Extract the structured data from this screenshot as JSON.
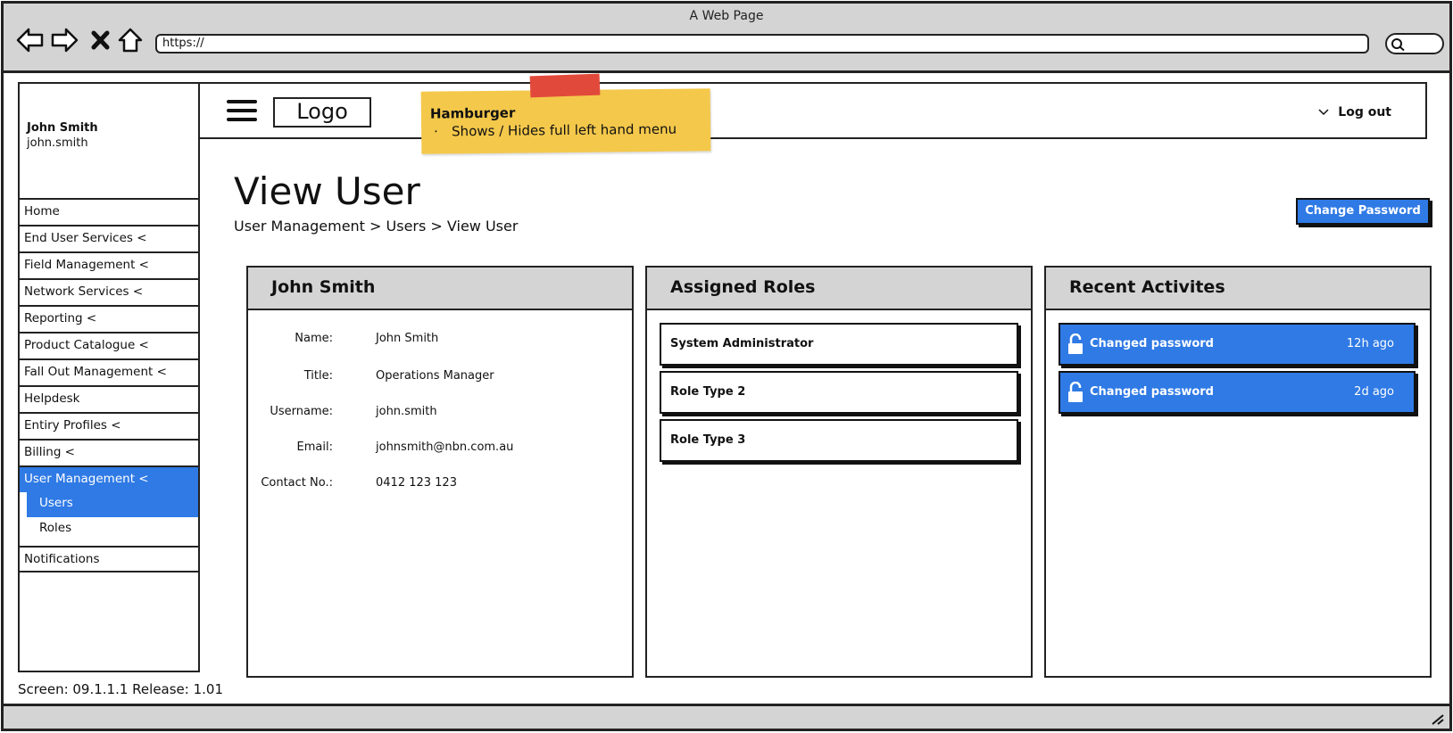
{
  "browser": {
    "window_title": "A Web Page",
    "url": "https://",
    "nav_icons": [
      "back-arrow-icon",
      "forward-arrow-icon",
      "close-x-icon",
      "home-icon"
    ],
    "search_icon": "search-icon"
  },
  "sidebar": {
    "user_name": "John Smith",
    "user_login": "john.smith",
    "items": [
      {
        "label": "Home"
      },
      {
        "label": "End User Services <"
      },
      {
        "label": "Field Management <"
      },
      {
        "label": "Network Services <"
      },
      {
        "label": "Reporting <"
      },
      {
        "label": "Product Catalogue <"
      },
      {
        "label": "Fall Out Management <"
      },
      {
        "label": "Helpdesk"
      },
      {
        "label": "Entiry Profiles <"
      },
      {
        "label": "Billing <"
      },
      {
        "label": "User Management <",
        "active": true
      }
    ],
    "submenu": [
      {
        "label": "Users",
        "active": true
      },
      {
        "label": "Roles"
      }
    ],
    "notifications": "Notifications"
  },
  "header": {
    "logo": "Logo",
    "logout": "Log out"
  },
  "sticky_note": {
    "title": "Hamburger",
    "text": "Shows / Hides full left hand menu"
  },
  "page": {
    "title": "View User",
    "breadcrumb": "User Management > Users > View User",
    "change_password": "Change Password"
  },
  "user_panel": {
    "heading": "John Smith",
    "fields": [
      {
        "label": "Name:",
        "value": "John Smith"
      },
      {
        "label": "Title:",
        "value": "Operations Manager"
      },
      {
        "label": "Username:",
        "value": "john.smith"
      },
      {
        "label": "Email:",
        "value": "johnsmith@nbn.com.au"
      },
      {
        "label": "Contact No.:",
        "value": "0412 123 123"
      }
    ]
  },
  "roles_panel": {
    "heading": "Assigned Roles",
    "roles": [
      "System Administrator",
      "Role Type 2",
      "Role Type 3"
    ]
  },
  "activity_panel": {
    "heading": "Recent Activites",
    "items": [
      {
        "text": "Changed password",
        "time": "12h ago",
        "icon": "unlock-icon"
      },
      {
        "text": "Changed password",
        "time": "2d ago",
        "icon": "unlock-icon"
      }
    ]
  },
  "footer": {
    "screen_info": "Screen: 09.1.1.1 Release: 1.01"
  }
}
